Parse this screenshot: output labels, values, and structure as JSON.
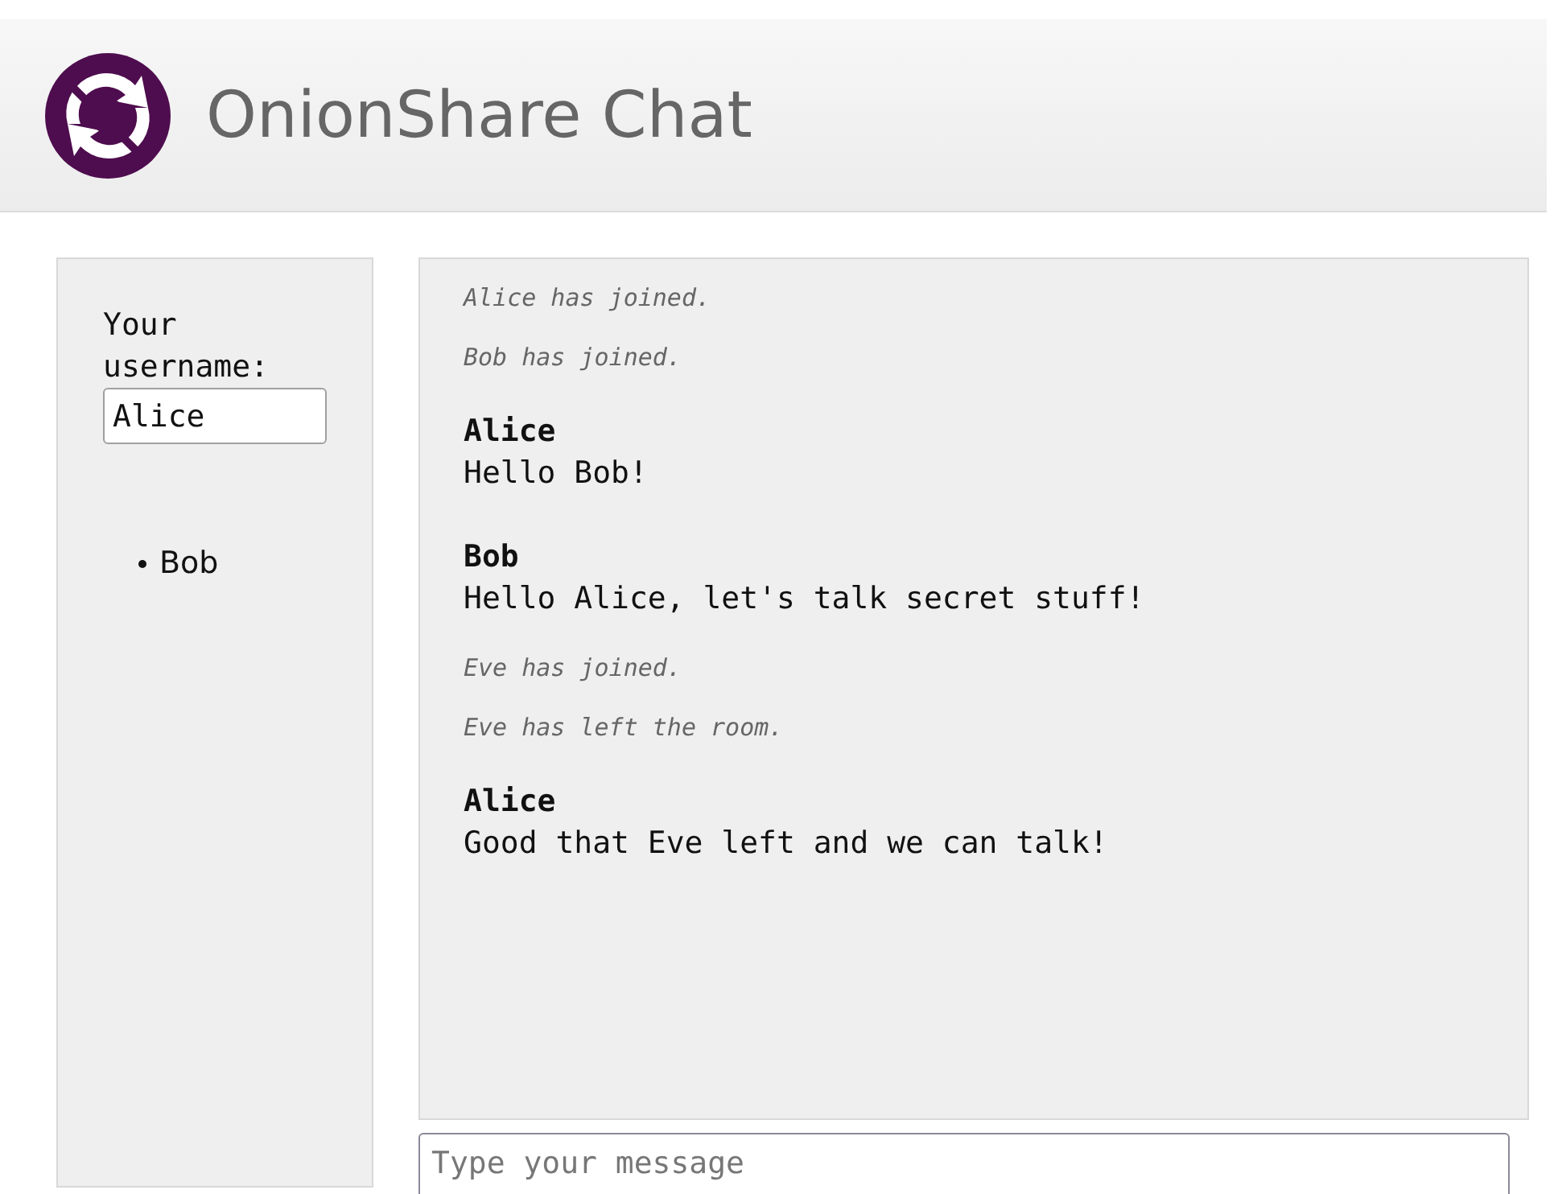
{
  "header": {
    "title": "OnionShare Chat"
  },
  "sidebar": {
    "username_label": "Your username:",
    "username": "Alice",
    "users": [
      "Bob"
    ]
  },
  "messages": [
    {
      "kind": "status",
      "text": "Alice has joined."
    },
    {
      "kind": "status",
      "text": "Bob has joined."
    },
    {
      "kind": "message",
      "username": "Alice",
      "text": "Hello Bob!"
    },
    {
      "kind": "message",
      "username": "Bob",
      "text": "Hello Alice, let's talk secret stuff!"
    },
    {
      "kind": "status",
      "text": "Eve has joined."
    },
    {
      "kind": "status",
      "text": "Eve has left the room."
    },
    {
      "kind": "message",
      "username": "Alice",
      "text": "Good that Eve left and we can talk!"
    }
  ],
  "composer": {
    "placeholder": "Type your message"
  }
}
